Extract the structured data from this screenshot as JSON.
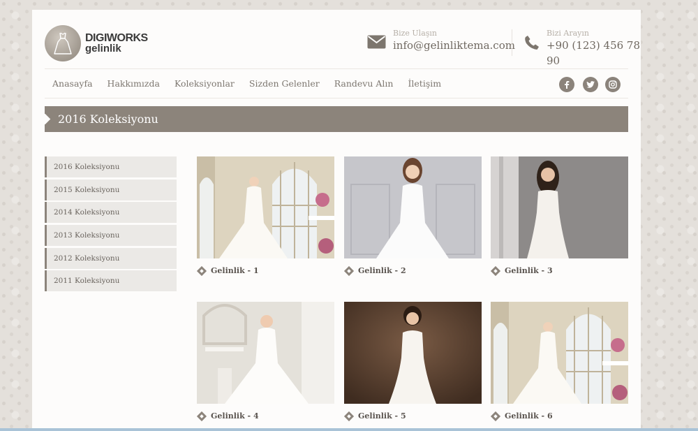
{
  "brand": {
    "name": "DIGIWORKS",
    "sub": "gelinlik"
  },
  "contact": {
    "mail_label": "Bize Ulaşın",
    "mail_value": "info@gelinliktema.com",
    "phone_label": "Bizi Arayın",
    "phone_value": "+90 (123) 456 78 90"
  },
  "nav": [
    "Anasayfa",
    "Hakkımızda",
    "Koleksiyonlar",
    "Sizden Gelenler",
    "Randevu Alın",
    "İletişim"
  ],
  "social": [
    "facebook-icon",
    "twitter-icon",
    "instagram-icon"
  ],
  "page_title": "2016 Koleksiyonu",
  "sidebar": [
    "2016 Koleksiyonu",
    "2015 Koleksiyonu",
    "2014 Koleksiyonu",
    "2013 Koleksiyonu",
    "2012 Koleksiyonu",
    "2011 Koleksiyonu"
  ],
  "gallery": [
    {
      "caption": "Gelinlik - 1",
      "scene": "window"
    },
    {
      "caption": "Gelinlik - 2",
      "scene": "grey"
    },
    {
      "caption": "Gelinlik - 3",
      "scene": "dark-grey"
    },
    {
      "caption": "Gelinlik - 4",
      "scene": "bright-room"
    },
    {
      "caption": "Gelinlik - 5",
      "scene": "brown"
    },
    {
      "caption": "Gelinlik - 6",
      "scene": "window"
    }
  ],
  "colors": {
    "accent": "#8c847b",
    "background": "#fdfcfb"
  }
}
